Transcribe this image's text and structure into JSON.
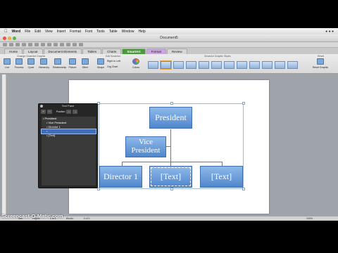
{
  "menubar": {
    "app": "Word",
    "items": [
      "File",
      "Edit",
      "View",
      "Insert",
      "Format",
      "Font",
      "Tools",
      "Table",
      "Window",
      "Help"
    ]
  },
  "window": {
    "title": "Document5"
  },
  "ribbon": {
    "tabs": [
      "Home",
      "Layout",
      "Document Elements",
      "Tables",
      "Charts",
      "SmartArt",
      "Format",
      "Review"
    ],
    "groups": {
      "change_graphic": "Change SmartArt Graphic",
      "edit": "Edit SmartArt",
      "styles": "SmartArt Graphic Styles",
      "reset": "Reset"
    },
    "buttons": [
      "List",
      "Process",
      "Cycle",
      "Hierarchy",
      "Relationship",
      "Picture",
      "Other",
      "Shape",
      "Right to Left",
      "Org Chart",
      "Colors",
      "Reset Graphic"
    ]
  },
  "text_pane": {
    "title": "Text Pane",
    "position_label": "Position",
    "items": [
      {
        "level": 1,
        "text": "President"
      },
      {
        "level": 2,
        "text": "Vice President"
      },
      {
        "level": 2,
        "text": "Director 1"
      },
      {
        "level": 2,
        "text": ""
      },
      {
        "level": 2,
        "text": "[Text]"
      }
    ]
  },
  "smartart": {
    "nodes": [
      "President",
      "Vice President",
      "Director 1",
      "[Text]",
      "[Text]"
    ]
  },
  "statusbar": {
    "items": [
      "Sec",
      "Pages:",
      "1 of 1",
      "Words:",
      "0 of 0"
    ],
    "zoom": "100%"
  },
  "watermark": "Screencast-O-Matic.com",
  "colors": {
    "node_top": "#8fb9ea",
    "node_bottom": "#4f87cc",
    "active_tab": "#4a9a3b"
  }
}
